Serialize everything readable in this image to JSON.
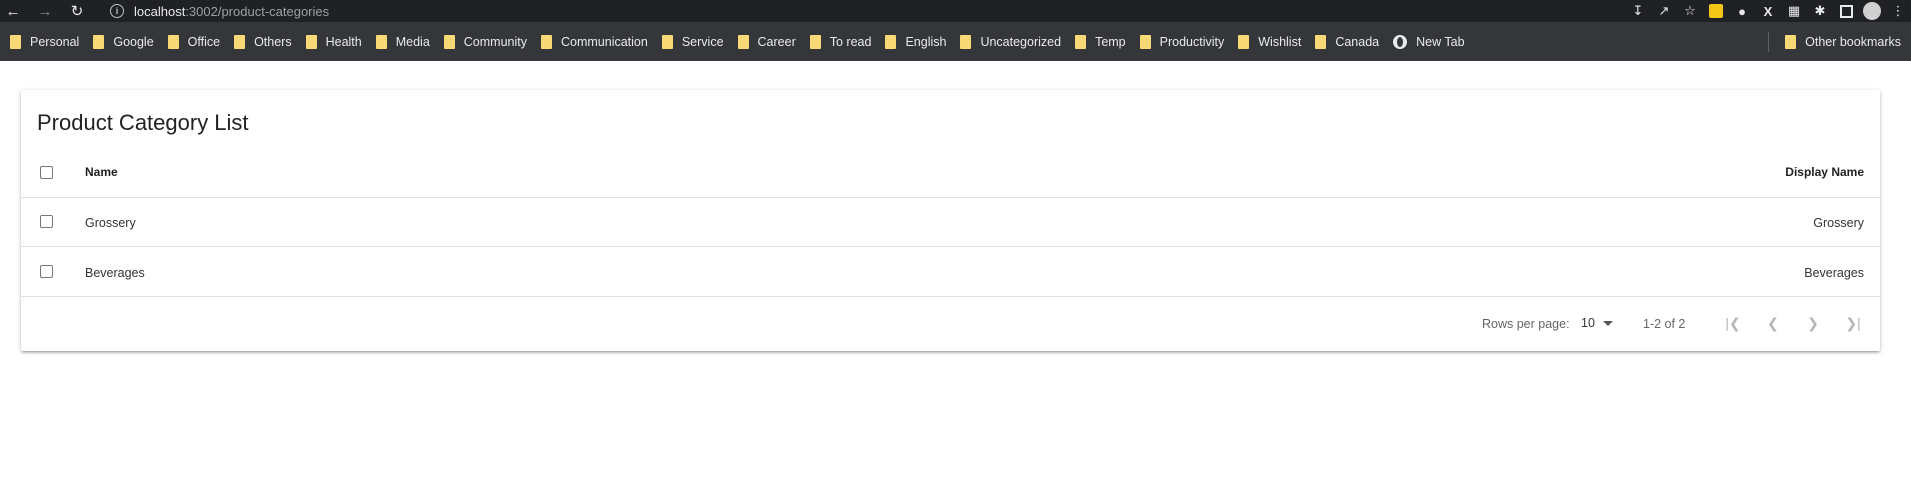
{
  "browser": {
    "url_host": "localhost",
    "url_path": ":3002/product-categories",
    "bookmarks": [
      "Personal",
      "Google",
      "Office",
      "Others",
      "Health",
      "Media",
      "Community",
      "Communication",
      "Service",
      "Career",
      "To read",
      "English",
      "Uncategorized",
      "Temp",
      "Productivity",
      "Wishlist",
      "Canada"
    ],
    "new_tab_label": "New Tab",
    "other_bookmarks_label": "Other bookmarks"
  },
  "page": {
    "title": "Product Category List",
    "columns": {
      "name": "Name",
      "display_name": "Display Name"
    },
    "rows": [
      {
        "name": "Grossery",
        "display_name": "Grossery"
      },
      {
        "name": "Beverages",
        "display_name": "Beverages"
      }
    ],
    "pagination": {
      "rows_per_page_label": "Rows per page:",
      "rows_per_page_value": "10",
      "range": "1-2 of 2"
    }
  }
}
